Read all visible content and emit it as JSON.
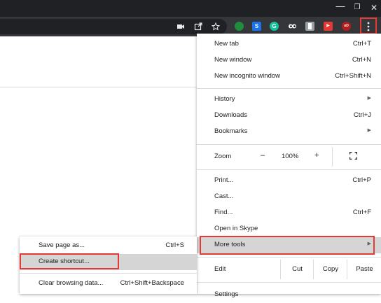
{
  "window": {
    "minimize": "—",
    "restore": "❐",
    "close": "✕"
  },
  "toolbar": {
    "omnibox_icons": [
      "camera-icon",
      "share-icon",
      "star-icon"
    ],
    "extensions": [
      {
        "name": "green-dot-extension-icon",
        "color": "#1e8e3e",
        "glyph": ""
      },
      {
        "name": "skype-extension-icon",
        "color": "#1a73e8",
        "glyph": "S"
      },
      {
        "name": "grammarly-extension-icon",
        "color": "#15c39a",
        "glyph": "G"
      },
      {
        "name": "eyes-extension-icon",
        "color": "#5f6368",
        "glyph": "👀"
      },
      {
        "name": "bookmark-extension-icon",
        "color": "#9aa0a6",
        "glyph": "▮"
      },
      {
        "name": "youtube-extension-icon",
        "color": "#e53935",
        "glyph": "▶"
      },
      {
        "name": "ublock-extension-icon",
        "color": "#b71c1c",
        "glyph": "uD"
      }
    ],
    "menu_glyph": "⋮"
  },
  "menu": {
    "group1": [
      {
        "label": "New tab",
        "shortcut": "Ctrl+T"
      },
      {
        "label": "New window",
        "shortcut": "Ctrl+N"
      },
      {
        "label": "New incognito window",
        "shortcut": "Ctrl+Shift+N"
      }
    ],
    "group2": [
      {
        "label": "History",
        "arrow": "▶"
      },
      {
        "label": "Downloads",
        "shortcut": "Ctrl+J"
      },
      {
        "label": "Bookmarks",
        "arrow": "▶"
      }
    ],
    "zoom": {
      "label": "Zoom",
      "minus": "–",
      "value": "100%",
      "plus": "+"
    },
    "group3": [
      {
        "label": "Print...",
        "shortcut": "Ctrl+P"
      },
      {
        "label": "Cast..."
      },
      {
        "label": "Find...",
        "shortcut": "Ctrl+F"
      },
      {
        "label": "Open in Skype"
      }
    ],
    "more_tools": {
      "label": "More tools",
      "arrow": "▶"
    },
    "edit": {
      "label": "Edit",
      "cut": "Cut",
      "copy": "Copy",
      "paste": "Paste"
    },
    "settings": {
      "label": "Settings"
    }
  },
  "submenu": {
    "items": [
      {
        "label": "Save page as...",
        "shortcut": "Ctrl+S"
      },
      {
        "label": "Create shortcut..."
      },
      {
        "label": "Clear browsing data...",
        "shortcut": "Ctrl+Shift+Backspace"
      }
    ]
  },
  "colors": {
    "highlight": "#e53935",
    "hover": "#d5d5d5"
  }
}
